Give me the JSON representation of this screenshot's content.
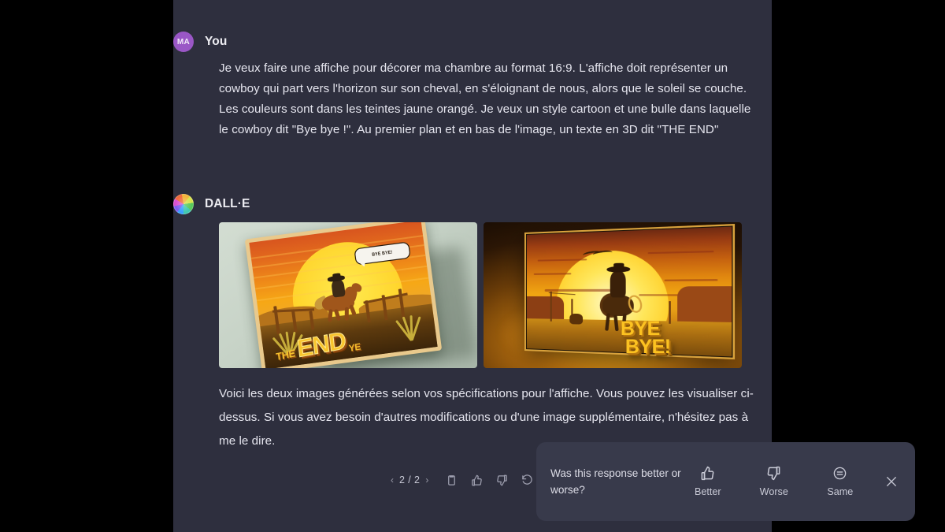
{
  "window": {
    "background": "#000000",
    "panel_background": "#2e2f3e"
  },
  "user_message": {
    "avatar_initials": "MA",
    "avatar_color": "#9a57c6",
    "sender": "You",
    "text": "Je veux faire une affiche pour décorer ma chambre au format 16:9. L'affiche doit représenter un cowboy qui part vers l'horizon sur son cheval, en s'éloignant de nous, alors que le soleil se couche. Les couleurs sont dans les teintes jaune orangé. Je veux un style cartoon et une bulle dans laquelle le cowboy dit \"Bye bye !\". Au premier plan et en bas de l'image, un texte en 3D dit \"THE END\""
  },
  "assistant_message": {
    "avatar_icon": "dalle-color-wheel-icon",
    "sender": "DALL·E",
    "images": [
      {
        "alt": "Affiche cartoon inclinée : cowboy à cheval devant un soleil couchant jaune, bulle BYE BYE! et texte 3D THE END",
        "bubble_text": "BYE BYE!",
        "title_small": "THE",
        "title_big": "END",
        "title_tail": "YE"
      },
      {
        "alt": "Panneau d'affichage éclairé : silhouette d'un cowboy à cheval vers le soleil couchant avec texte 3D BYE BYE!",
        "text_line1": "BYE",
        "text_line2": "BYE!"
      }
    ],
    "text": "Voici les deux images générées selon vos spécifications pour l'affiche. Vous pouvez les visualiser ci-dessus. Si vous avez besoin d'autres modifications ou d'une image supplémentaire, n'hésitez pas à me le dire."
  },
  "toolbar": {
    "prev_label": "‹",
    "page_indicator": "2 / 2",
    "next_label": "›",
    "copy_icon": "copy-icon",
    "thumbs_up_icon": "thumbs-up-icon",
    "thumbs_down_icon": "thumbs-down-icon",
    "regenerate_icon": "regenerate-icon"
  },
  "feedback": {
    "question": "Was this response better or worse?",
    "better_label": "Better",
    "worse_label": "Worse",
    "same_label": "Same",
    "close_icon": "close-icon",
    "background": "#383a4b"
  }
}
